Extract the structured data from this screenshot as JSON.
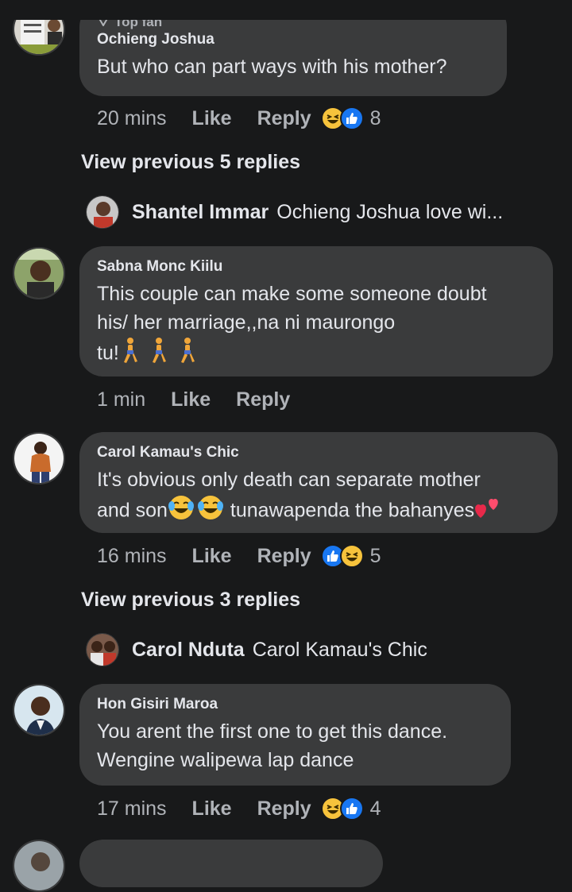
{
  "comments": [
    {
      "badge": "Top fan",
      "author": "Ochieng Joshua",
      "text": "But who can part ways with his mother?",
      "time": "20 mins",
      "like": "Like",
      "reply": "Reply",
      "reactions": [
        "haha",
        "like"
      ],
      "count": "8"
    },
    {
      "author": "Sabna Monc Kiilu",
      "line1": "This couple can make some someone doubt",
      "line2": "his/ her marriage,,na ni maurongo",
      "line3": "tu!",
      "emoji": "person-walking",
      "time": "1 min",
      "like": "Like",
      "reply": "Reply"
    },
    {
      "author": "Carol Kamau's Chic",
      "line1": "It's obvious only death can separate mother",
      "line2a": "and son",
      "line2b": " tunawapenda the bahanyes",
      "emoji1": "tears-of-joy",
      "emoji2": "two-hearts",
      "time": "16 mins",
      "like": "Like",
      "reply": "Reply",
      "reactions": [
        "like",
        "haha"
      ],
      "count": "5"
    },
    {
      "author": "Hon Gisiri Maroa",
      "line1": "You arent the first one to get this dance.",
      "line2": "Wengine walipewa lap dance",
      "time": "17 mins",
      "like": "Like",
      "reply": "Reply",
      "reactions": [
        "haha",
        "like"
      ],
      "count": "4"
    }
  ],
  "view_previous": [
    "View previous 5 replies",
    "View previous 3 replies"
  ],
  "reply_previews": [
    {
      "name": "Shantel Immar",
      "text": "Ochieng Joshua love wi..."
    },
    {
      "name": "Carol Nduta",
      "text": "Carol Kamau's Chic"
    }
  ],
  "colors": {
    "background": "#18191a",
    "bubble": "#3a3b3c",
    "muted": "#b0b3b8",
    "like_blue": "#1877f2",
    "haha_yellow": "#f7c33c"
  },
  "icons": [
    "top-fan-diamond-icon",
    "like-reaction-icon",
    "haha-reaction-icon",
    "person-walking-emoji",
    "tears-of-joy-emoji",
    "two-hearts-emoji"
  ]
}
